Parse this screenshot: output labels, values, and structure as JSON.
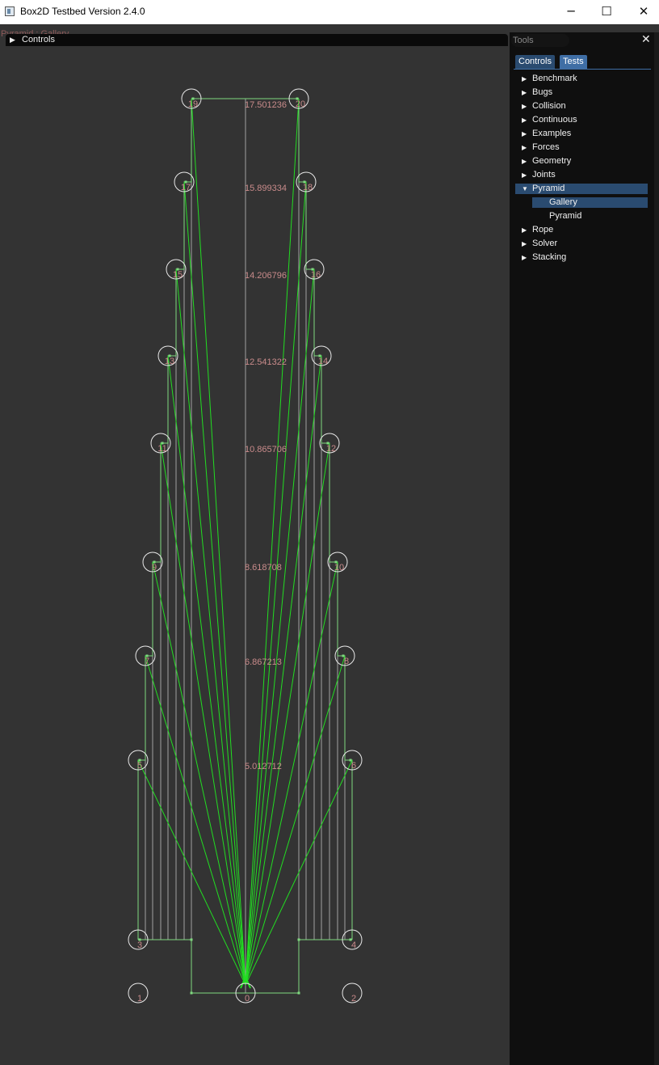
{
  "window": {
    "title": "Box2D Testbed Version 2.4.0",
    "minimize_glyph": "─",
    "maximize_glyph": "☐",
    "close_glyph": "✕"
  },
  "scene": {
    "test_title": "Pyramid : Gallery",
    "height_labels": [
      "17.501236",
      "15.899334",
      "14.206796",
      "12.541322",
      "10.865706",
      "8.618708",
      "6.867213",
      "5.012712"
    ],
    "node_labels": [
      "0",
      "1",
      "2",
      "3",
      "4",
      "5",
      "6",
      "7",
      "8",
      "9",
      "10",
      "11",
      "12",
      "13",
      "14",
      "15",
      "16",
      "17",
      "18",
      "19",
      "20"
    ],
    "colors": {
      "background": "#333333",
      "joint_line": "#22dd22",
      "structure_line": "#7fd87f",
      "post_line": "#a0a0a0",
      "circle": "#e8e8e8",
      "label": "#c98b8b"
    }
  },
  "controls": {
    "label": "Controls",
    "collapsed_glyph": "▶"
  },
  "tools": {
    "title": "Tools",
    "close_glyph": "✕",
    "tabs": [
      {
        "label": "Controls",
        "active": false
      },
      {
        "label": "Tests",
        "active": true
      }
    ],
    "categories": [
      {
        "label": "Benchmark",
        "glyph": "▶"
      },
      {
        "label": "Bugs",
        "glyph": "▶"
      },
      {
        "label": "Collision",
        "glyph": "▶"
      },
      {
        "label": "Continuous",
        "glyph": "▶"
      },
      {
        "label": "Examples",
        "glyph": "▶"
      },
      {
        "label": "Forces",
        "glyph": "▶"
      },
      {
        "label": "Geometry",
        "glyph": "▶"
      },
      {
        "label": "Joints",
        "glyph": "▶"
      },
      {
        "label": "Pyramid",
        "glyph": "▼"
      },
      {
        "label": "Gallery"
      },
      {
        "label": "Pyramid"
      },
      {
        "label": "Rope",
        "glyph": "▶"
      },
      {
        "label": "Solver",
        "glyph": "▶"
      },
      {
        "label": "Stacking",
        "glyph": "▶"
      }
    ],
    "selected_category": "Pyramid",
    "selected_test": "Gallery"
  }
}
